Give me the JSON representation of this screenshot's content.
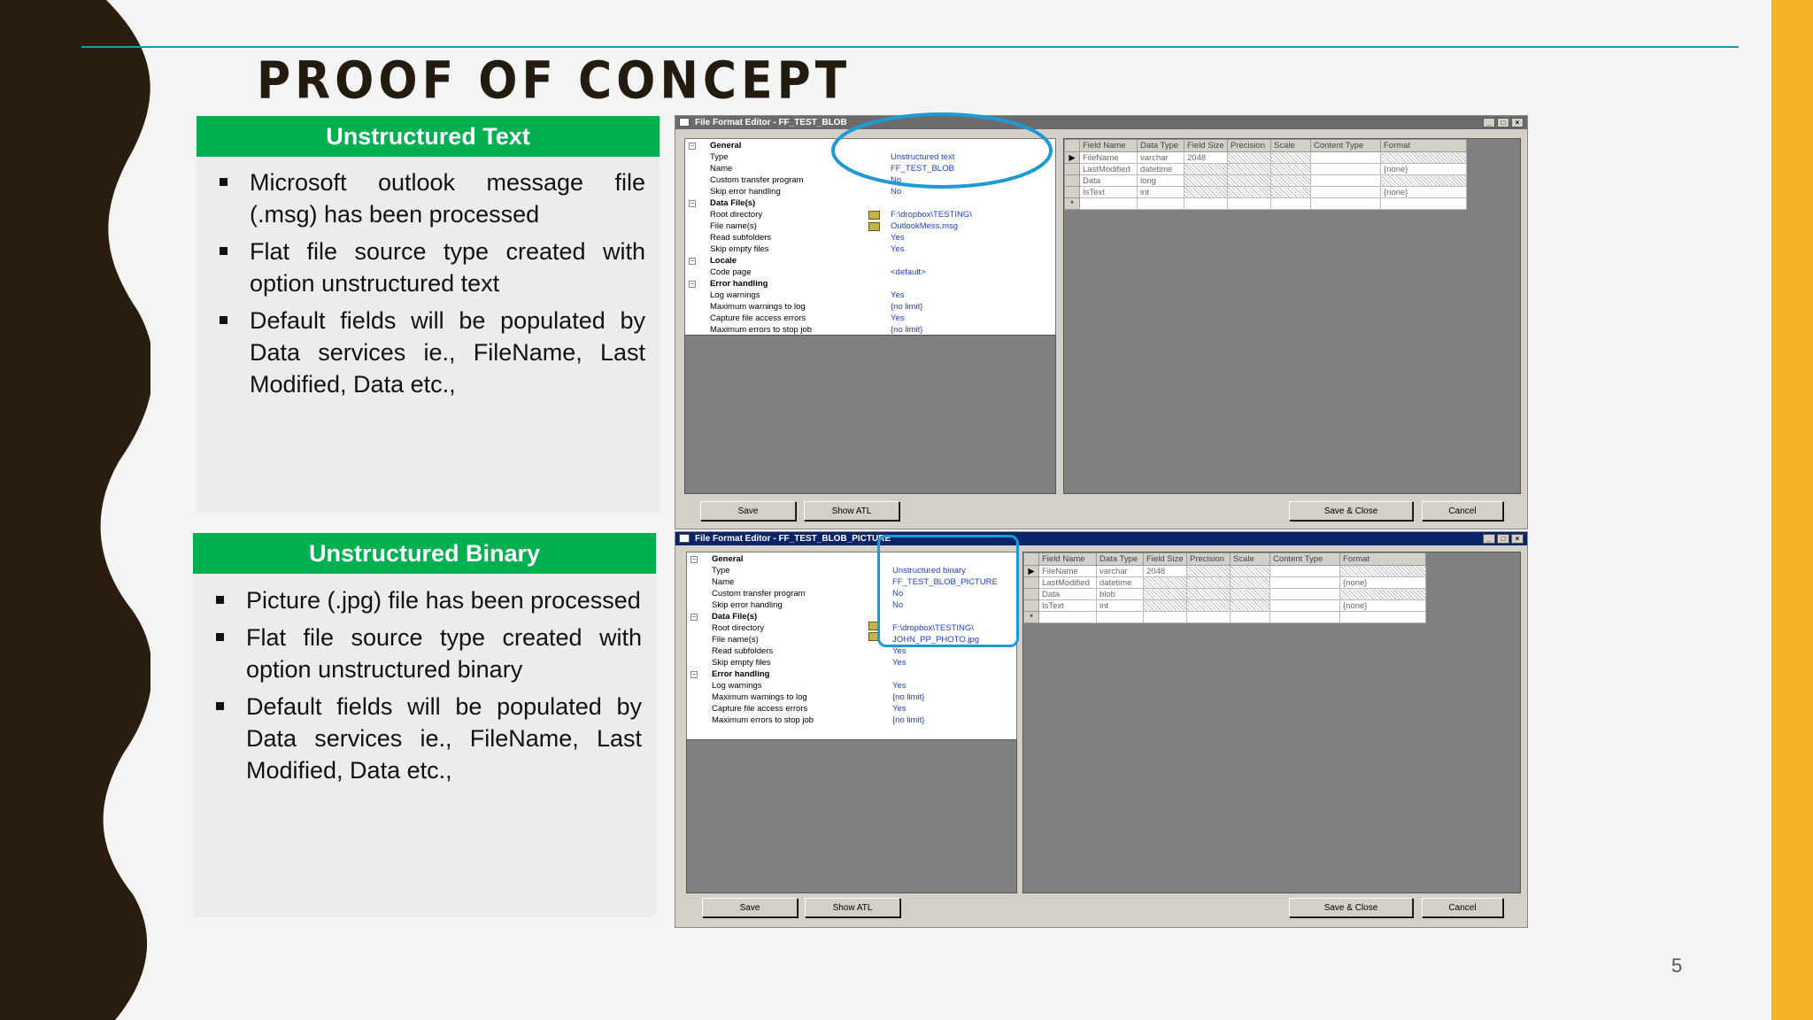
{
  "slide": {
    "title": "PROOF OF CONCEPT",
    "page_number": "5",
    "colors": {
      "accent_green": "#00b050",
      "side_bar": "#f6b226",
      "rule": "#1f9aa8",
      "wave": "#2a1d0e"
    }
  },
  "panels": [
    {
      "heading": "Unstructured Text",
      "bullets": [
        "Microsoft outlook message file (.msg) has been processed",
        "Flat file source type created with option unstructured text",
        "Default fields will be populated by Data services ie., FileName, Last Modified, Data etc.,"
      ]
    },
    {
      "heading": "Unstructured Binary",
      "bullets": [
        "Picture (.jpg) file has been processed",
        "Flat file source type created with option unstructured binary",
        "Default fields will be populated by Data services ie., FileName, Last Modified, Data etc.,"
      ]
    }
  ],
  "windows": [
    {
      "title": "File Format Editor - FF_TEST_BLOB",
      "title_bar_color": "#6b6b6b",
      "props": [
        {
          "label": "General",
          "section": true,
          "value": ""
        },
        {
          "label": "Type",
          "value": "Unstructured text"
        },
        {
          "label": "Name",
          "value": "FF_TEST_BLOB"
        },
        {
          "label": "Custom transfer program",
          "value": "No"
        },
        {
          "label": "Skip error handling",
          "value": "No"
        },
        {
          "label": "Data File(s)",
          "section": true,
          "value": ""
        },
        {
          "label": "Root directory",
          "value": "F:\\dropbox\\TESTING\\"
        },
        {
          "label": "File name(s)",
          "value": "OutlookMess.msg"
        },
        {
          "label": "Read subfolders",
          "value": "Yes"
        },
        {
          "label": "Skip empty files",
          "value": "Yes"
        },
        {
          "label": "Locale",
          "section": true,
          "value": ""
        },
        {
          "label": "Code page",
          "value": "<default>"
        },
        {
          "label": "Error handling",
          "section": true,
          "value": ""
        },
        {
          "label": "Log warnings",
          "value": "Yes"
        },
        {
          "label": "Maximum warnings to log",
          "value": "{no limit}"
        },
        {
          "label": "Capture file access errors",
          "value": "Yes"
        },
        {
          "label": "Maximum errors to stop job",
          "value": "{no limit}"
        }
      ],
      "columns": [
        "Field Name",
        "Data Type",
        "Field Size",
        "Precision",
        "Scale",
        "Content Type",
        "Format"
      ],
      "rows": [
        [
          "FileName",
          "varchar",
          "2048",
          "",
          "",
          "",
          ""
        ],
        [
          "LastModified",
          "datetime",
          "",
          "",
          "",
          "",
          "{none}"
        ],
        [
          "Data",
          "long",
          "",
          "",
          "",
          "",
          ""
        ],
        [
          "IsText",
          "int",
          "",
          "",
          "",
          "",
          "{none}"
        ]
      ],
      "buttons": {
        "save": "Save",
        "show_atl": "Show ATL",
        "save_close": "Save & Close",
        "cancel": "Cancel"
      }
    },
    {
      "title": "File Format Editor - FF_TEST_BLOB_PICTURE",
      "title_bar_color": "#0a246a",
      "props": [
        {
          "label": "General",
          "section": true,
          "value": ""
        },
        {
          "label": "Type",
          "value": "Unstructured binary"
        },
        {
          "label": "Name",
          "value": "FF_TEST_BLOB_PICTURE"
        },
        {
          "label": "Custom transfer program",
          "value": "No"
        },
        {
          "label": "Skip error handling",
          "value": "No"
        },
        {
          "label": "Data File(s)",
          "section": true,
          "value": ""
        },
        {
          "label": "Root directory",
          "value": "F:\\dropbox\\TESTING\\"
        },
        {
          "label": "File name(s)",
          "value": "JOHN_PP_PHOTO.jpg"
        },
        {
          "label": "Read subfolders",
          "value": "Yes"
        },
        {
          "label": "Skip empty files",
          "value": "Yes"
        },
        {
          "label": "Error handling",
          "section": true,
          "value": ""
        },
        {
          "label": "Log warnings",
          "value": "Yes"
        },
        {
          "label": "Maximum warnings to log",
          "value": "{no limit}"
        },
        {
          "label": "Capture file access errors",
          "value": "Yes"
        },
        {
          "label": "Maximum errors to stop job",
          "value": "{no limit}"
        }
      ],
      "columns": [
        "Field Name",
        "Data Type",
        "Field Size",
        "Precision",
        "Scale",
        "Content Type",
        "Format"
      ],
      "rows": [
        [
          "FileName",
          "varchar",
          "2048",
          "",
          "",
          "",
          ""
        ],
        [
          "LastModified",
          "datetime",
          "",
          "",
          "",
          "",
          "{none}"
        ],
        [
          "Data",
          "blob",
          "",
          "",
          "",
          "",
          ""
        ],
        [
          "IsText",
          "int",
          "",
          "",
          "",
          "",
          "{none}"
        ]
      ],
      "buttons": {
        "save": "Save",
        "show_atl": "Show ATL",
        "save_close": "Save & Close",
        "cancel": "Cancel"
      }
    }
  ]
}
